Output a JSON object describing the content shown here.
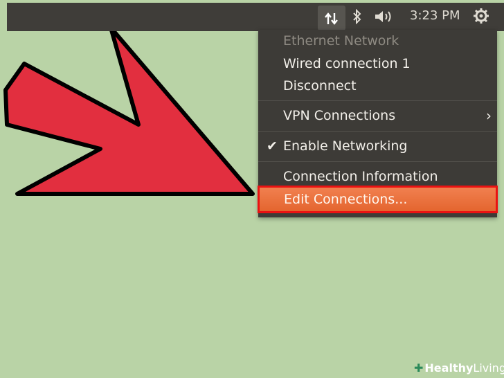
{
  "panel": {
    "clock": "3:23 PM",
    "icons": [
      "network-updown-icon",
      "bluetooth-icon",
      "volume-icon",
      "gear-icon"
    ]
  },
  "menu": {
    "header": "Ethernet Network",
    "wired": "Wired connection 1",
    "disconnect": "Disconnect",
    "vpn": "VPN Connections",
    "enable_networking": "Enable Networking",
    "connection_info": "Connection Information",
    "edit_connections": "Edit Connections...",
    "check_mark": "✔",
    "submenu_chevron": "›"
  },
  "colors": {
    "background": "#b9d3a6",
    "panel": "#3f3d39",
    "menu": "#3d3b37",
    "highlight": "#ea6a34",
    "highlight_border": "#ea1212",
    "arrow": "#e22f3f"
  },
  "watermark": {
    "brand_bold": "Healthy",
    "brand_light": "Living"
  }
}
